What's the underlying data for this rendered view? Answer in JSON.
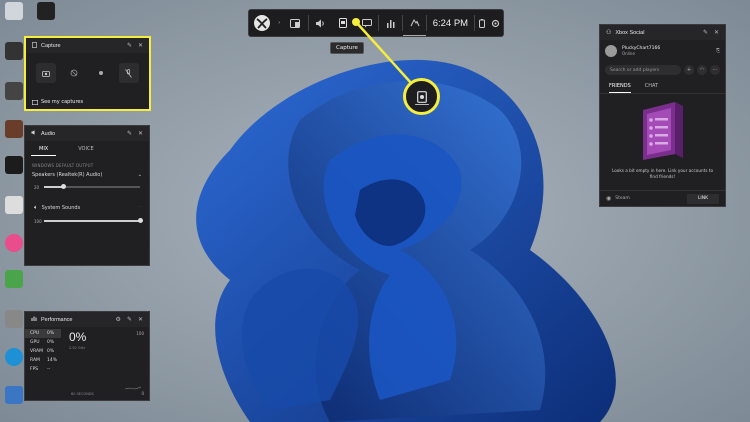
{
  "gamebar": {
    "time": "6:24 PM",
    "tooltip": "Capture",
    "buttons": [
      "widget-menu-icon",
      "audio-icon",
      "capture-icon",
      "social-icon",
      "performance-icon",
      "xbox-icon"
    ]
  },
  "capture": {
    "title": "Capture",
    "see_captures": "See my captures"
  },
  "audio": {
    "title": "Audio",
    "tabs": [
      "MIX",
      "VOICE"
    ],
    "default_output_label": "WINDOWS DEFAULT OUTPUT",
    "device": "Speakers (Realtek(R) Audio)",
    "device_volume": 0.2,
    "device_volume_text": "20",
    "system_sounds_label": "System Sounds",
    "system_sounds_volume": 1.0,
    "system_sounds_volume_text": "100"
  },
  "performance": {
    "title": "Performance",
    "rows": [
      {
        "key": "CPU",
        "value": "0%"
      },
      {
        "key": "GPU",
        "value": "0%"
      },
      {
        "key": "VRAM",
        "value": "0%"
      },
      {
        "key": "RAM",
        "value": "14%"
      },
      {
        "key": "FPS",
        "value": "--"
      }
    ],
    "big_value": "0%",
    "ghz": "2.92 GHz",
    "max": "100",
    "min": "0",
    "window": "60 SECONDS"
  },
  "social": {
    "title": "Xbox Social",
    "username": "PluckyChart7166",
    "status": "Online",
    "search_placeholder": "Search or add players",
    "tabs": [
      "FRIENDS",
      "CHAT"
    ],
    "empty_text": "Looks a bit empty in here. Link your accounts to find friends!",
    "steam_label": "Steam",
    "link_label": "LINK"
  },
  "colors": {
    "highlight": "#f6ee3c",
    "panel_bg": "#202022",
    "wallpaper_blue": "#1b4fa8"
  }
}
